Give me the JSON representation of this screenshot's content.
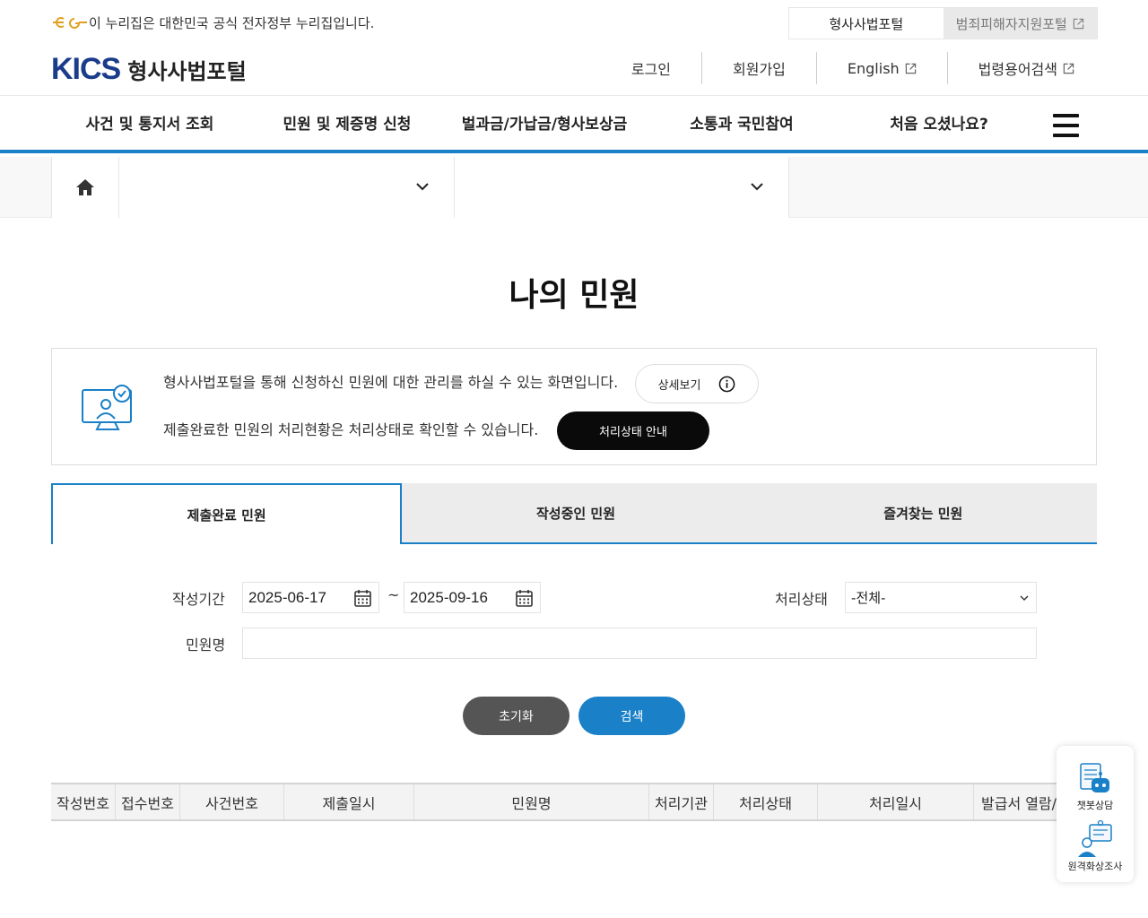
{
  "header": {
    "gov_banner": "이 누리집은 대한민국 공식 전자정부 누리집입니다.",
    "portal_tabs": [
      {
        "label": "형사사법포털"
      },
      {
        "label": "범죄피해자지원포털"
      }
    ],
    "brand_logo": "KICS",
    "brand_name": "형사사법포털",
    "util_links": [
      {
        "label": "로그인"
      },
      {
        "label": "회원가입"
      },
      {
        "label": "English"
      },
      {
        "label": "법령용어검색"
      }
    ]
  },
  "gnb": {
    "items": [
      {
        "label": "사건 및 통지서 조회"
      },
      {
        "label": "민원 및 제증명 신청"
      },
      {
        "label": "벌과금/가납금/형사보상금"
      },
      {
        "label": "소통과 국민참여"
      },
      {
        "label": "처음 오셨나요?"
      }
    ]
  },
  "breadcrumb": {
    "select1": "",
    "select2": ""
  },
  "page": {
    "title": "나의 민원"
  },
  "info": {
    "line1": "형사사법포털을 통해 신청하신 민원에 대한 관리를 하실 수 있는 화면입니다.",
    "detail_label": "상세보기",
    "line2": "제출완료한 민원의 처리현황은 처리상태로 확인할 수 있습니다.",
    "status_guide_label": "처리상태 안내"
  },
  "tabs": [
    {
      "label": "제출완료 민원",
      "active": true
    },
    {
      "label": "작성중인 민원",
      "active": false
    },
    {
      "label": "즐겨찾는 민원",
      "active": false
    }
  ],
  "search": {
    "period_label": "작성기간",
    "date_from": "2025-06-17",
    "date_to": "2025-09-16",
    "tilde": "~",
    "status_label": "처리상태",
    "status_selected": "-전체-",
    "name_label": "민원명",
    "name_value": "",
    "reset_label": "초기화",
    "search_label": "검색"
  },
  "table": {
    "columns": [
      "작성번호",
      "접수번호",
      "사건번호",
      "제출일시",
      "민원명",
      "처리기관",
      "처리상태",
      "처리일시",
      "발급서 열람/"
    ]
  },
  "float_widget": {
    "chatbot_label": "챗봇상담",
    "remote_label": "원격화상조사"
  },
  "colors": {
    "accent": "#1a80c8",
    "brand_navy": "#1b3c8a",
    "dark_button": "#0a0a0a",
    "reset_button": "#555555"
  }
}
